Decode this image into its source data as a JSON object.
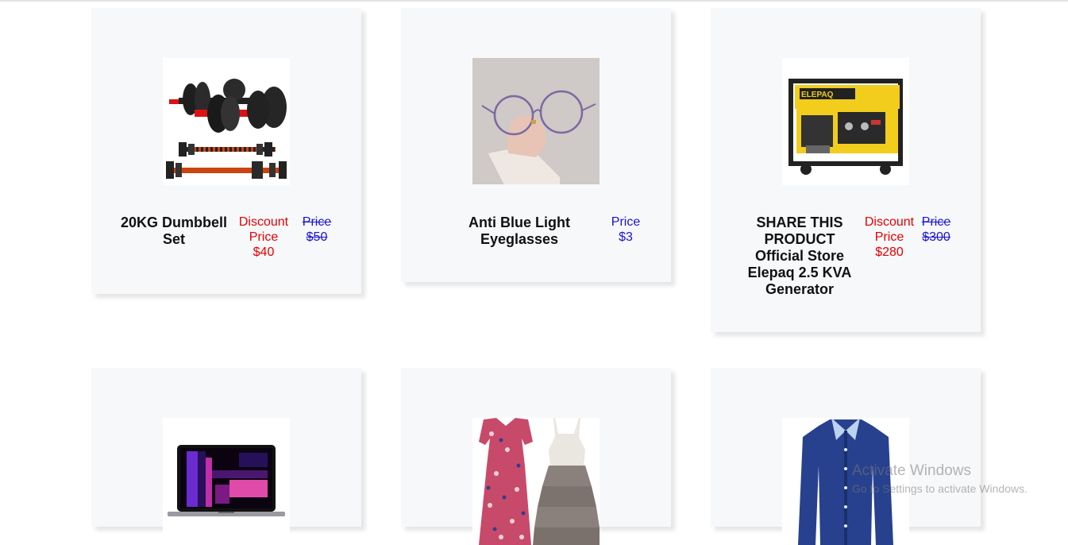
{
  "products": [
    {
      "name": "20KG Dumbbell Set",
      "discount_label": "Discount Price",
      "discount_price": "$40",
      "price_label": "Price",
      "price": "$50",
      "image": "dumbbell-set-image"
    },
    {
      "name": "Anti Blue Light Eyeglasses",
      "price_label": "Price",
      "price": "$3",
      "image": "eyeglasses-image"
    },
    {
      "name": "SHARE THIS PRODUCT Official Store Elepaq 2.5 KVA Generator",
      "discount_label": "Discount Price",
      "discount_price": "$280",
      "price_label": "Price",
      "price": "$300",
      "image": "generator-image"
    },
    {
      "image": "laptop-image"
    },
    {
      "image": "dresses-image"
    },
    {
      "image": "shirt-image"
    }
  ],
  "watermark": {
    "title": "Activate Windows",
    "subtitle": "Go to Settings to activate Windows."
  },
  "colors": {
    "card_bg": "#f7f8fa",
    "discount": "#e50000",
    "price": "#1a12d6"
  }
}
